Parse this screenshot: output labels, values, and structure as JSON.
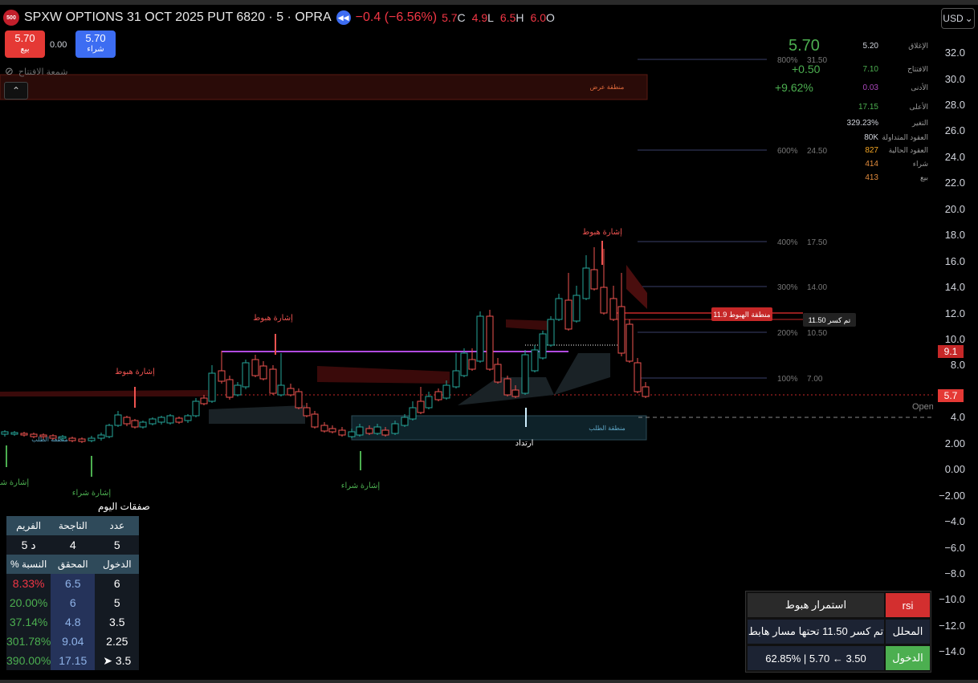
{
  "header": {
    "logo": "500",
    "symbol": "SPXW OPTIONS 31 OCT 2025 PUT 6820 · 5 · OPRA",
    "change": "−0.4 (−6.56%)",
    "ohlc": [
      {
        "value": "5.7",
        "label": "C"
      },
      {
        "value": "4.9",
        "label": "L"
      },
      {
        "value": "6.5",
        "label": "H"
      },
      {
        "value": "6.0",
        "label": "O"
      }
    ],
    "currency": "USD"
  },
  "trade": {
    "sell_price": "5.70",
    "sell_label": "بيع",
    "spread": "0.00",
    "buy_price": "5.70",
    "buy_label": "شراء"
  },
  "open_candle_label": "شمعة الافتتاح",
  "info": {
    "big_price": "5.70",
    "change": "+0.50",
    "change_pct": "+9.62%",
    "rows": [
      {
        "label": "الإغلاق",
        "value": "5.20",
        "color": "#d1d4dc"
      },
      {
        "label": "الافتتاح",
        "value": "7.10",
        "color": "#4caf50"
      },
      {
        "label": "الأدنى",
        "value": "0.03",
        "color": "#ab47bc"
      },
      {
        "label": "الأعلى",
        "value": "17.15",
        "color": "#4caf50"
      },
      {
        "label": "التغير",
        "value": "329.23%",
        "color": "#d1d4dc"
      },
      {
        "label": "العقود المتداولة",
        "value": "80K",
        "color": "#d1d4dc"
      },
      {
        "label": "العقود الحالية",
        "value": "827",
        "color": "#f5a623"
      },
      {
        "label": "شراء",
        "value": "414",
        "color": "#e08a3c"
      },
      {
        "label": "بيع",
        "value": "413",
        "color": "#e08a3c"
      }
    ]
  },
  "fib_levels": [
    {
      "pct": "800%",
      "price": "31.50"
    },
    {
      "pct": "600%",
      "price": "24.50"
    },
    {
      "pct": "400%",
      "price": "17.50"
    },
    {
      "pct": "300%",
      "price": "14.00"
    },
    {
      "pct": "200%",
      "price": "10.50"
    },
    {
      "pct": "100%",
      "price": "7.00"
    }
  ],
  "zones": {
    "supply": "منطقة عرض",
    "demand": "منطقة الطلب",
    "demand_left": "منطقة الطلب",
    "bear_zone": "منطقة الهبوط 11.9",
    "break_label": "تم كسر 11.50",
    "opening": "Openir"
  },
  "signals": {
    "sell": "إشارة هبوط",
    "buy": "إشارة شراء",
    "bounce": "ارتداد"
  },
  "yaxis": {
    "ticks": [
      "32.0",
      "30.0",
      "28.0",
      "26.0",
      "24.0",
      "22.0",
      "20.0",
      "18.0",
      "16.0",
      "14.0",
      "12.0",
      "10.0",
      "8.0",
      "4.0",
      "2.00",
      "0.00",
      "−2.00",
      "−4.0",
      "−6.0",
      "−8.0",
      "−10.0",
      "−12.0",
      "−14.0"
    ],
    "badge_top": "9.1",
    "badge_last": "5.7"
  },
  "deals": {
    "title": "صفقات اليوم",
    "head1": [
      "الفريم",
      "الناجحة",
      "عدد"
    ],
    "row1": [
      "5 د",
      "4",
      "5"
    ],
    "head2": [
      "% النسبة",
      "المحقق",
      "الدخول"
    ],
    "rows": [
      [
        "8.33%",
        "6.5",
        "6"
      ],
      [
        "20.00%",
        "6",
        "5"
      ],
      [
        "37.14%",
        "4.8",
        "3.5"
      ],
      [
        "301.78%",
        "9.04",
        "2.25"
      ],
      [
        "390.00%",
        "17.15",
        "➤ 3.5"
      ]
    ]
  },
  "dashboard": {
    "trend": "استمرار هبوط",
    "indicator": "rsi",
    "analysis": "تم كسر 11.50 تحتها مسار هابط",
    "analysis_label": "المحلل",
    "entry": "62.85% | 5.70 ← 3.50",
    "entry_label": "الدخول"
  }
}
